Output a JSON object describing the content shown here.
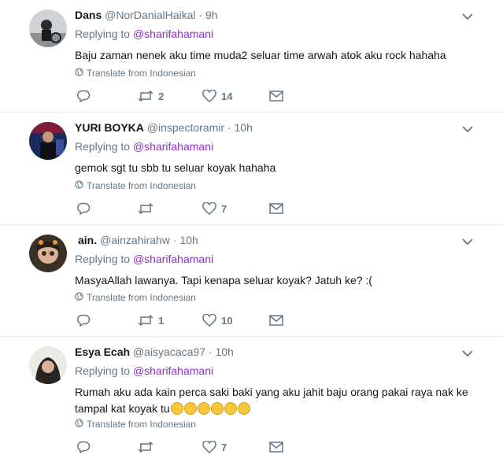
{
  "tweets": [
    {
      "name": "Dans",
      "handle": "@NorDanialHaikal",
      "dot": "·",
      "time": "9h",
      "replying_label": "Replying to",
      "replying_to": "@sharifahamani",
      "text": "Baju zaman nenek aku time muda2 seluar time arwah atok aku rock hahaha",
      "translate": "Translate from Indonesian",
      "retweets": "2",
      "likes": "14"
    },
    {
      "name": "YURI BOYKA",
      "handle": "@inspectoramir",
      "dot": "·",
      "time": "10h",
      "replying_label": "Replying to",
      "replying_to": "@sharifahamani",
      "text": "gemok sgt tu sbb tu seluar koyak hahaha",
      "translate": "Translate from Indonesian",
      "retweets": "",
      "likes": "7"
    },
    {
      "name": "ain.",
      "handle": "@ainzahirahw",
      "dot": "·",
      "time": "10h",
      "replying_label": "Replying to",
      "replying_to": "@sharifahamani",
      "text": "MasyaAllah lawanya. Tapi kenapa seluar koyak? Jatuh ke? :(",
      "translate": "Translate from Indonesian",
      "retweets": "1",
      "likes": "10"
    },
    {
      "name": "Esya Ecah",
      "handle": "@aisyacaca97",
      "dot": "·",
      "time": "10h",
      "replying_label": "Replying to",
      "replying_to": "@sharifahamani",
      "text": "Rumah aku ada kain perca saki baki yang aku jahit baju orang pakai raya nak ke tampal kat koyak tu",
      "translate": "Translate from Indonesian",
      "retweets": "",
      "likes": "7",
      "emojis": [
        "sweat-smile-emoji",
        "grimace-emoji",
        "disappointed-emoji",
        "disappointed-emoji",
        "relieved-emoji",
        "relieved-emoji"
      ]
    }
  ],
  "colors": {
    "mention": "#8f2ec4",
    "muted": "#657786",
    "border": "#e6ecf0"
  },
  "icons": [
    "chevron-down-icon",
    "globe-icon",
    "reply-icon",
    "retweet-icon",
    "heart-icon",
    "mail-icon"
  ]
}
